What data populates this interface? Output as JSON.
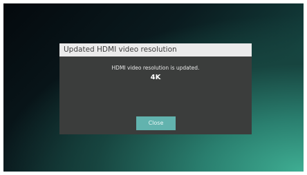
{
  "dialog": {
    "title": "Updated HDMI video resolution",
    "message": "HDMI video resolution is updated.",
    "value": "4K",
    "close_label": "Close"
  },
  "colors": {
    "title_bar": "#ebebeb",
    "dialog_body": "#3b3d3c",
    "button": "#62b3ae"
  }
}
